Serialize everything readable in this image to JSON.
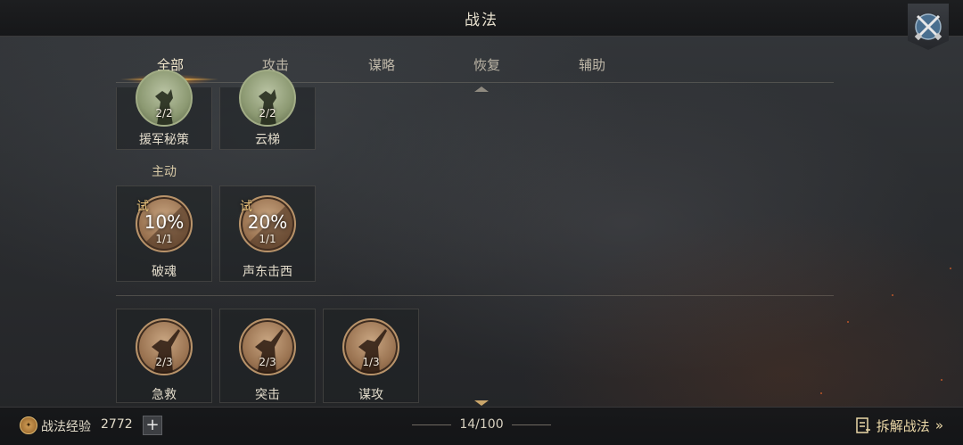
{
  "header": {
    "title": "战法"
  },
  "tabs": [
    {
      "label": "全部",
      "active": true
    },
    {
      "label": "攻击",
      "active": false
    },
    {
      "label": "谋略",
      "active": false
    },
    {
      "label": "恢复",
      "active": false
    },
    {
      "label": "辅助",
      "active": false
    }
  ],
  "top_row": [
    {
      "name": "援军秘策",
      "count": "2/2",
      "icon": "soldier-silhouette-icon"
    },
    {
      "name": "云梯",
      "count": "2/2",
      "icon": "soldier-silhouette-icon"
    }
  ],
  "active_section": {
    "label": "主动",
    "cards": [
      {
        "name": "破魂",
        "count": "1/1",
        "trial": "试",
        "percent": "10%"
      },
      {
        "name": "声东击西",
        "count": "1/1",
        "trial": "试",
        "percent": "20%"
      }
    ]
  },
  "bottom_row": [
    {
      "name": "急救",
      "count": "2/3"
    },
    {
      "name": "突击",
      "count": "2/3"
    },
    {
      "name": "谋攻",
      "count": "1/3"
    }
  ],
  "footer": {
    "exp_label": "战法经验",
    "exp_value": "2772",
    "plus": "+",
    "page": "14/100",
    "decompose_label": "拆解战法",
    "decompose_arrow": "»"
  },
  "colors": {
    "accent": "#f0b24a",
    "badge_border": "#b8936a"
  }
}
